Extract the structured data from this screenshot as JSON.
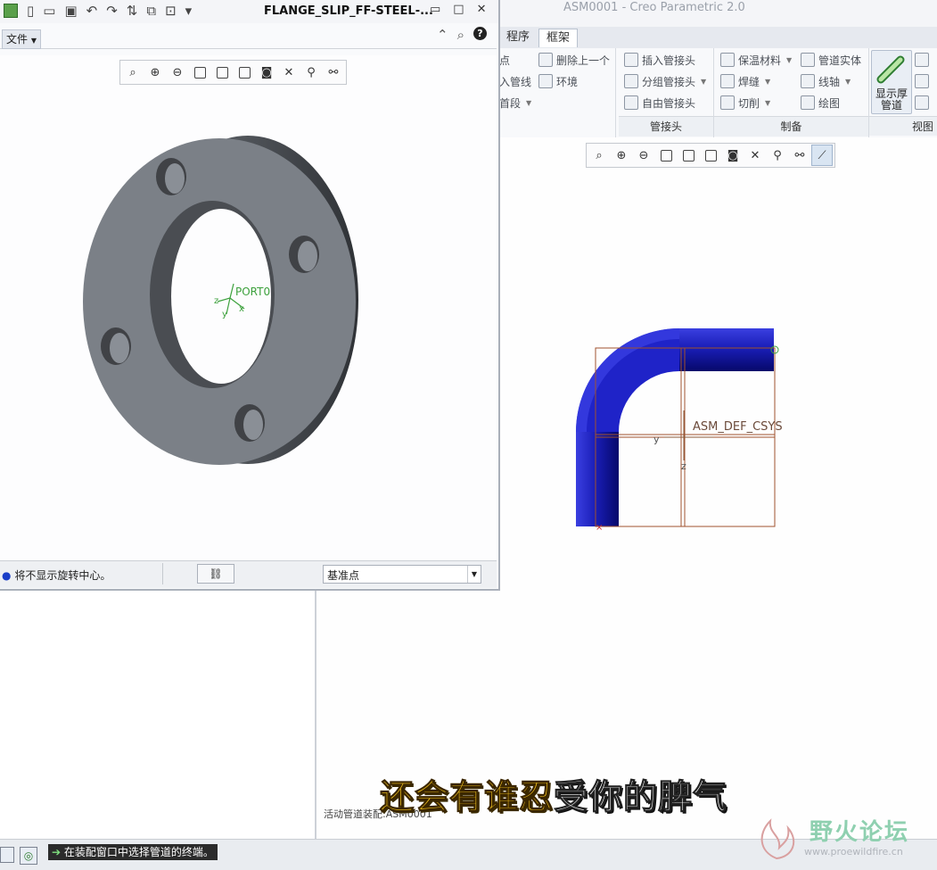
{
  "main_window": {
    "title": "ASM0001 - Creo Parametric 2.0"
  },
  "tabs": [
    {
      "label": "程序"
    },
    {
      "label": "框架"
    }
  ],
  "ribbon": {
    "col1": [
      "点",
      "入管线",
      "首段"
    ],
    "col2": [
      "删除上一个",
      "环境"
    ],
    "col3": [
      "插入管接头",
      "分组管接头",
      "自由管接头"
    ],
    "col4": [
      "保温材料",
      "焊缝",
      "切削"
    ],
    "col5": [
      "管道实体",
      "线轴",
      "绘图"
    ],
    "big_button": {
      "line1": "显示厚",
      "line2": "管道"
    },
    "groups": [
      "管接头",
      "制备",
      "视图"
    ]
  },
  "sub_window": {
    "title": "FLANGE_SLIP_FF-STEEL-...",
    "file_menu": "文件",
    "status_text": "将不显示旋转中心。",
    "select_value": "基准点"
  },
  "flange": {
    "csys_label": "PORT0",
    "axes": [
      "z",
      "y",
      "x"
    ]
  },
  "pipe": {
    "csys_label": "ASM_DEF_CSYS",
    "axes": [
      "y",
      "z"
    ]
  },
  "main_gfx": {
    "info_text": "活动管道装配:ASM0001"
  },
  "status_bar": {
    "message": "在装配窗口中选择管道的终端。"
  },
  "subtitle": {
    "part1": "还会有谁忍",
    "part2": "受你的脾气"
  },
  "watermark": {
    "text": "野火论坛",
    "url": "www.proewildfire.cn"
  },
  "colors": {
    "pipe": "#1f23c8",
    "flange": "#7b8087",
    "csys": "#3da13d",
    "bbox": "#a0522d"
  }
}
